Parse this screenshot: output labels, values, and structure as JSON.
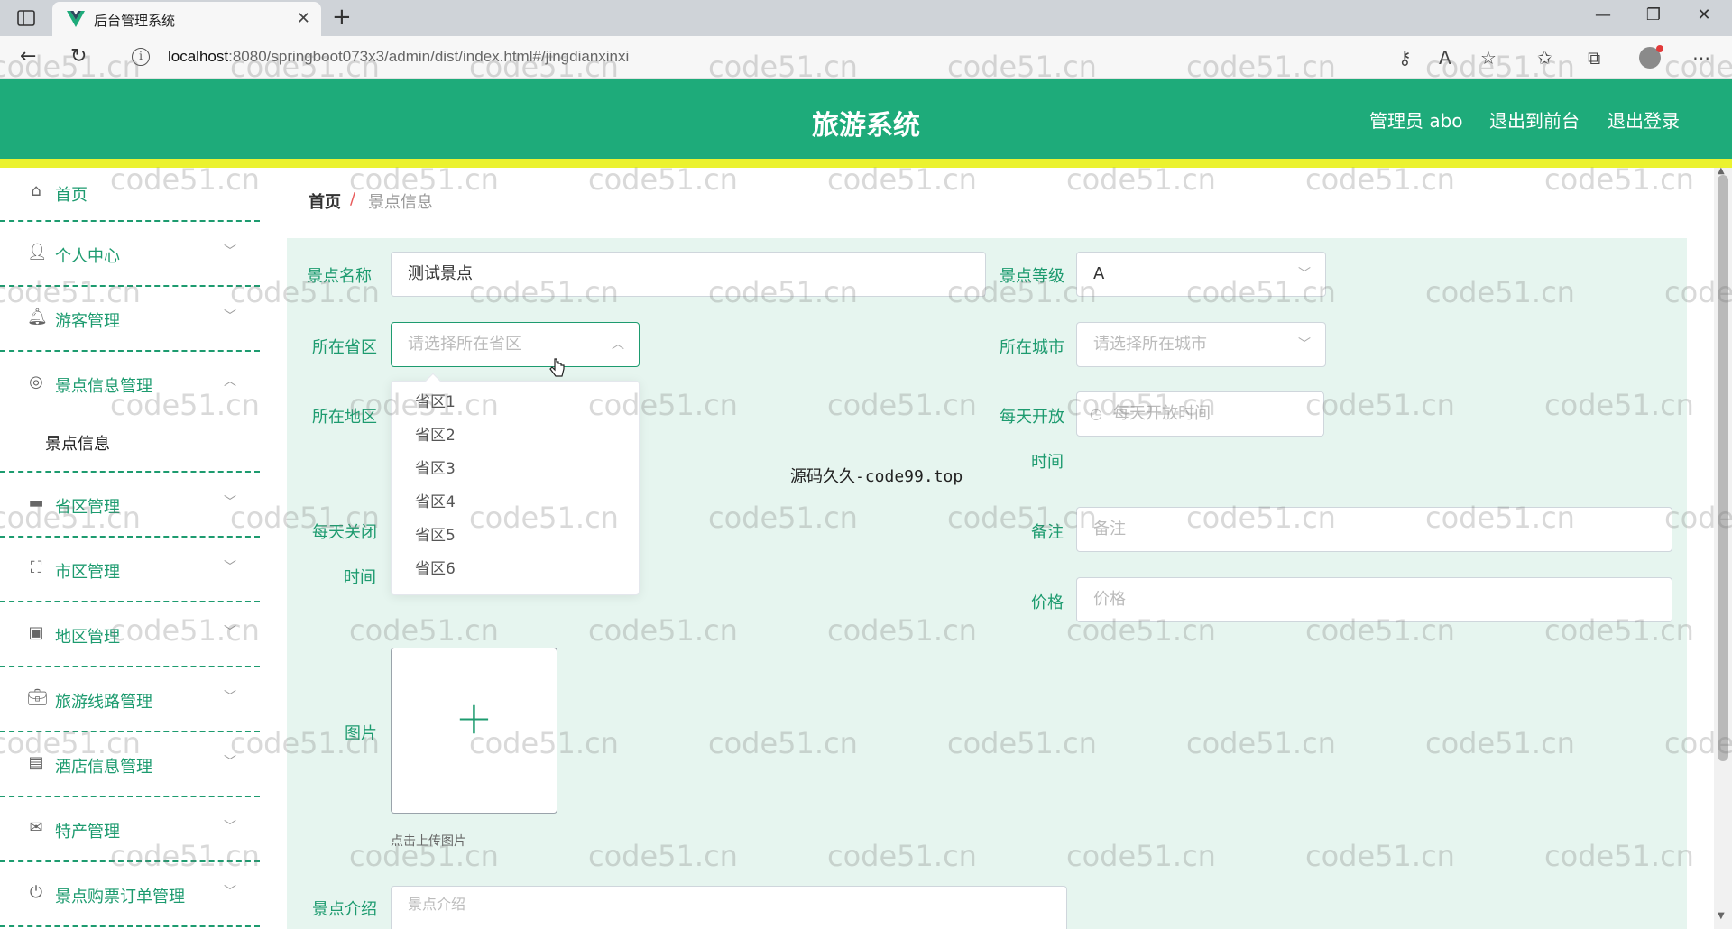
{
  "browser": {
    "tab_title": "后台管理系统",
    "url_host": "localhost",
    "url_rest": ":8080/springboot073x3/admin/dist/index.html#/jingdianxinxi"
  },
  "header": {
    "title": "旅游系统",
    "user": "管理员 abo",
    "to_front": "退出到前台",
    "logout": "退出登录"
  },
  "sidebar": {
    "items": [
      {
        "label": "首页",
        "icon": "home-icon"
      },
      {
        "label": "个人中心",
        "icon": "user-icon"
      },
      {
        "label": "游客管理",
        "icon": "bell-icon"
      },
      {
        "label": "景点信息管理",
        "icon": "compass-icon",
        "expanded": true,
        "children": [
          {
            "label": "景点信息"
          }
        ]
      },
      {
        "label": "省区管理",
        "icon": "chat-icon"
      },
      {
        "label": "市区管理",
        "icon": "fullscreen-icon"
      },
      {
        "label": "地区管理",
        "icon": "wallet-icon"
      },
      {
        "label": "旅游线路管理",
        "icon": "briefcase-icon"
      },
      {
        "label": "酒店信息管理",
        "icon": "document-icon"
      },
      {
        "label": "特产管理",
        "icon": "mail-icon"
      },
      {
        "label": "景点购票订单管理",
        "icon": "power-icon"
      }
    ]
  },
  "breadcrumb": {
    "home": "首页",
    "separator": "/",
    "current": "景点信息"
  },
  "form": {
    "name_label": "景点名称",
    "name_value": "测试景点",
    "level_label": "景点等级",
    "level_value": "A",
    "province_label": "所在省区",
    "province_placeholder": "请选择所在省区",
    "city_label": "所在城市",
    "city_placeholder": "请选择所在城市",
    "area_label": "所在地区",
    "open_label_1": "每天开放",
    "open_label_2": "时间",
    "open_placeholder": "每天开放时间",
    "close_label_1": "每天关闭",
    "close_label_2": "时间",
    "remark_label": "备注",
    "remark_placeholder": "备注",
    "price_label": "价格",
    "price_placeholder": "价格",
    "image_label": "图片",
    "upload_hint": "点击上传图片",
    "intro_label": "景点介绍",
    "intro_placeholder": "景点介绍"
  },
  "province_dropdown": {
    "options": [
      "省区1",
      "省区2",
      "省区3",
      "省区4",
      "省区5",
      "省区6"
    ]
  },
  "caption": "源码久久-code99.top",
  "watermark": "code51.cn",
  "colors": {
    "brand": "#1eab7a",
    "accent_stripe": "#ebf22f",
    "panel_bg": "#e6f5ef",
    "label": "#1d9b6f"
  }
}
